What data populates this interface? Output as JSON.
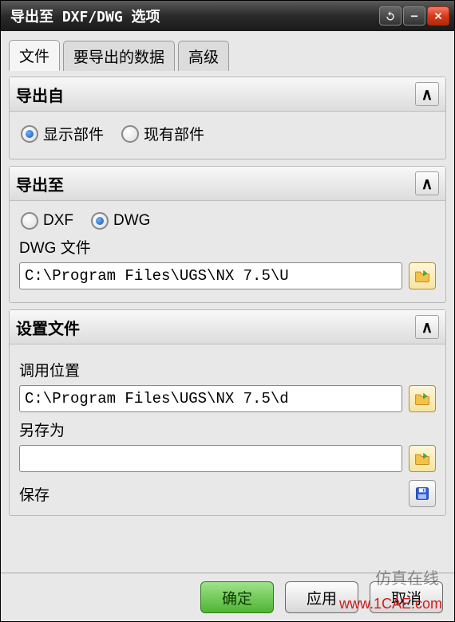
{
  "window": {
    "title": "导出至 DXF/DWG 选项"
  },
  "tabs": [
    {
      "label": "文件",
      "active": true
    },
    {
      "label": "要导出的数据",
      "active": false
    },
    {
      "label": "高级",
      "active": false
    }
  ],
  "sections": {
    "export_from": {
      "title": "导出自",
      "radios": {
        "display_part": "显示部件",
        "existing_part": "现有部件",
        "selected": "display_part"
      }
    },
    "export_to": {
      "title": "导出至",
      "radios": {
        "dxf": "DXF",
        "dwg": "DWG",
        "selected": "dwg"
      },
      "file_label": "DWG 文件",
      "file_value": "C:\\Program Files\\UGS\\NX 7.5\\U"
    },
    "settings_file": {
      "title": "设置文件",
      "call_location_label": "调用位置",
      "call_location_value": "C:\\Program Files\\UGS\\NX 7.5\\d",
      "save_as_label": "另存为",
      "save_as_value": "",
      "save_label": "保存"
    }
  },
  "buttons": {
    "ok": "确定",
    "apply": "应用",
    "cancel": "取消"
  },
  "collapse_glyph": "∧",
  "watermarks": {
    "line1": "仿真在线",
    "line2": "www.1CAE.com"
  }
}
